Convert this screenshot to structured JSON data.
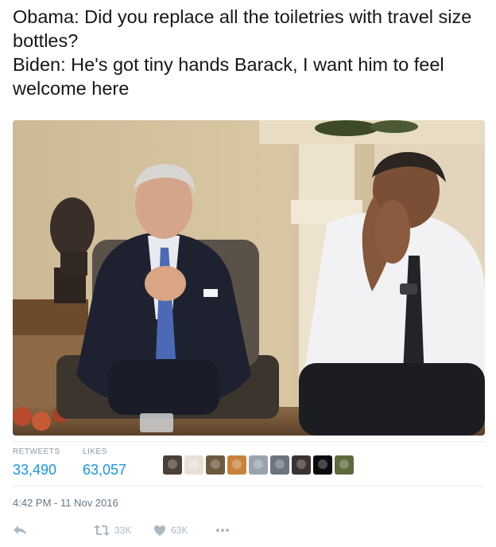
{
  "tweet": {
    "lines": [
      "Obama: Did you replace all the toiletries with travel size bottles?",
      "Biden: He's got tiny hands Barack, I want him to feel welcome here"
    ]
  },
  "stats": {
    "retweets_label": "RETWEETS",
    "retweets_value": "33,490",
    "likes_label": "LIKES",
    "likes_value": "63,057"
  },
  "likers": [
    {
      "icon": "avatar",
      "color": "#4a4036"
    },
    {
      "icon": "avatar",
      "color": "#e8e0d8"
    },
    {
      "icon": "avatar",
      "color": "#6b5a3e"
    },
    {
      "icon": "avatar",
      "color": "#c8823a"
    },
    {
      "icon": "avatar",
      "color": "#9aa3ad"
    },
    {
      "icon": "avatar",
      "color": "#6d7480"
    },
    {
      "icon": "avatar",
      "color": "#3a3330"
    },
    {
      "icon": "avatar",
      "color": "#0b0b0b"
    },
    {
      "icon": "avatar",
      "color": "#5b6b3a"
    }
  ],
  "timestamp": "4:42 PM - 11 Nov 2016",
  "actions": {
    "reply_icon": "reply-icon",
    "retweet_icon": "retweet-icon",
    "retweet_count": "33K",
    "like_icon": "heart-icon",
    "like_count": "63K",
    "more_icon": "more-icon"
  },
  "colors": {
    "text": "#14171a",
    "link": "#1b95e0",
    "muted": "#8899a6",
    "icon": "#aab8c2",
    "divider": "#e6ecf0"
  }
}
